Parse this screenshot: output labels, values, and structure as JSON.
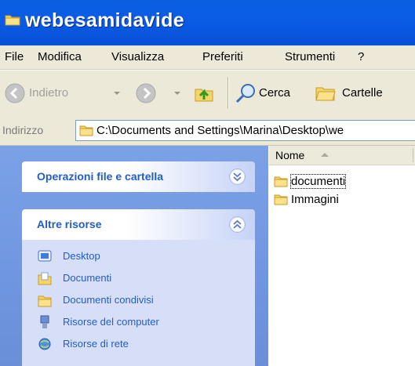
{
  "window": {
    "title": "webesamidavide"
  },
  "menu": {
    "items": [
      "File",
      "Modifica",
      "Visualizza",
      "Preferiti",
      "Strumenti",
      "?"
    ]
  },
  "toolbar": {
    "back_label": "Indietro",
    "search_label": "Cerca",
    "folders_label": "Cartelle"
  },
  "address": {
    "label": "Indirizzo",
    "value": "C:\\Documents and Settings\\Marina\\Desktop\\we"
  },
  "taskpane": {
    "panels": [
      {
        "title": "Operazioni file e cartella",
        "state": "collapsed",
        "toggle_icon": "chevron-down-icon"
      },
      {
        "title": "Altre risorse",
        "state": "expanded",
        "toggle_icon": "chevron-up-icon",
        "links": [
          {
            "label": "Desktop",
            "icon": "desktop-icon"
          },
          {
            "label": "Documenti",
            "icon": "documents-folder-icon"
          },
          {
            "label": "Documenti condivisi",
            "icon": "shared-folder-icon"
          },
          {
            "label": "Risorse del computer",
            "icon": "my-computer-icon"
          },
          {
            "label": "Risorse di rete",
            "icon": "network-places-icon"
          }
        ]
      }
    ]
  },
  "filelist": {
    "column_name": "Nome",
    "sort": "ascending",
    "items": [
      {
        "name": "documenti",
        "type": "folder"
      },
      {
        "name": "Immagini",
        "type": "folder"
      }
    ]
  },
  "colors": {
    "titlebar": "#0a5fe0",
    "chrome": "#ece9d8",
    "taskpane_bg": "#7ba2e7",
    "panel_body": "#d6dff7",
    "link_text": "#215dc6"
  }
}
